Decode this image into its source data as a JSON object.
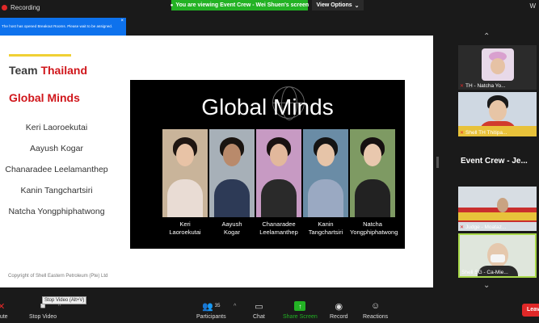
{
  "topbar": {
    "recording_label": "Recording",
    "viewing_label": "You are viewing Event Crew - Wei Shuen's screen",
    "view_options_label": "View Options",
    "right_glyph": "W"
  },
  "notification": {
    "text": "The host has opened Breakout Rooms. Please wait to be assigned.",
    "close": "×"
  },
  "slide": {
    "team_prefix": "Team ",
    "team_country": "Thailand",
    "subtitle": "Global Minds",
    "members": [
      "Keri Laoroekutai",
      "Aayush Kogar",
      "Chanaradee Leelamanthep",
      "Kanin Tangchartsiri",
      "Natcha Yongphiphatwong"
    ],
    "copyright": "Copyright of Shell Eastern Petroleum (Pte) Ltd",
    "panel_title": "Global Minds",
    "panel_people": [
      {
        "line1": "Keri",
        "line2": "Laoroekutai"
      },
      {
        "line1": "Aayush",
        "line2": "Kogar"
      },
      {
        "line1": "Chanaradee",
        "line2": "Leelamanthep"
      },
      {
        "line1": "Kanin",
        "line2": "Tangchartsiri"
      },
      {
        "line1": "Natcha",
        "line2": "Yongphiphatwong"
      }
    ]
  },
  "participants_panel": {
    "tiles": [
      {
        "label": "TH - Natcha Yo..."
      },
      {
        "label": "Shell TH Thitipa..."
      },
      {
        "label": "Judge - Moataz..."
      },
      {
        "label": "Shell SG - Ca-Mie..."
      }
    ],
    "event_crew_label": "Event Crew - Je..."
  },
  "toolbar": {
    "unmute_label": "mute",
    "stop_video_label": "Stop Video",
    "stop_video_tooltip": "Stop Video (Alt+V)",
    "participants_label": "Participants",
    "participants_count": "35",
    "chat_label": "Chat",
    "share_label": "Share Screen",
    "record_label": "Record",
    "reactions_label": "Reactions",
    "leave_label": "Leave"
  },
  "colors": {
    "accent_red": "#d0161b",
    "share_green": "#23b224",
    "zoom_blue": "#0e72ed",
    "accent_yellow": "#f0d034"
  }
}
